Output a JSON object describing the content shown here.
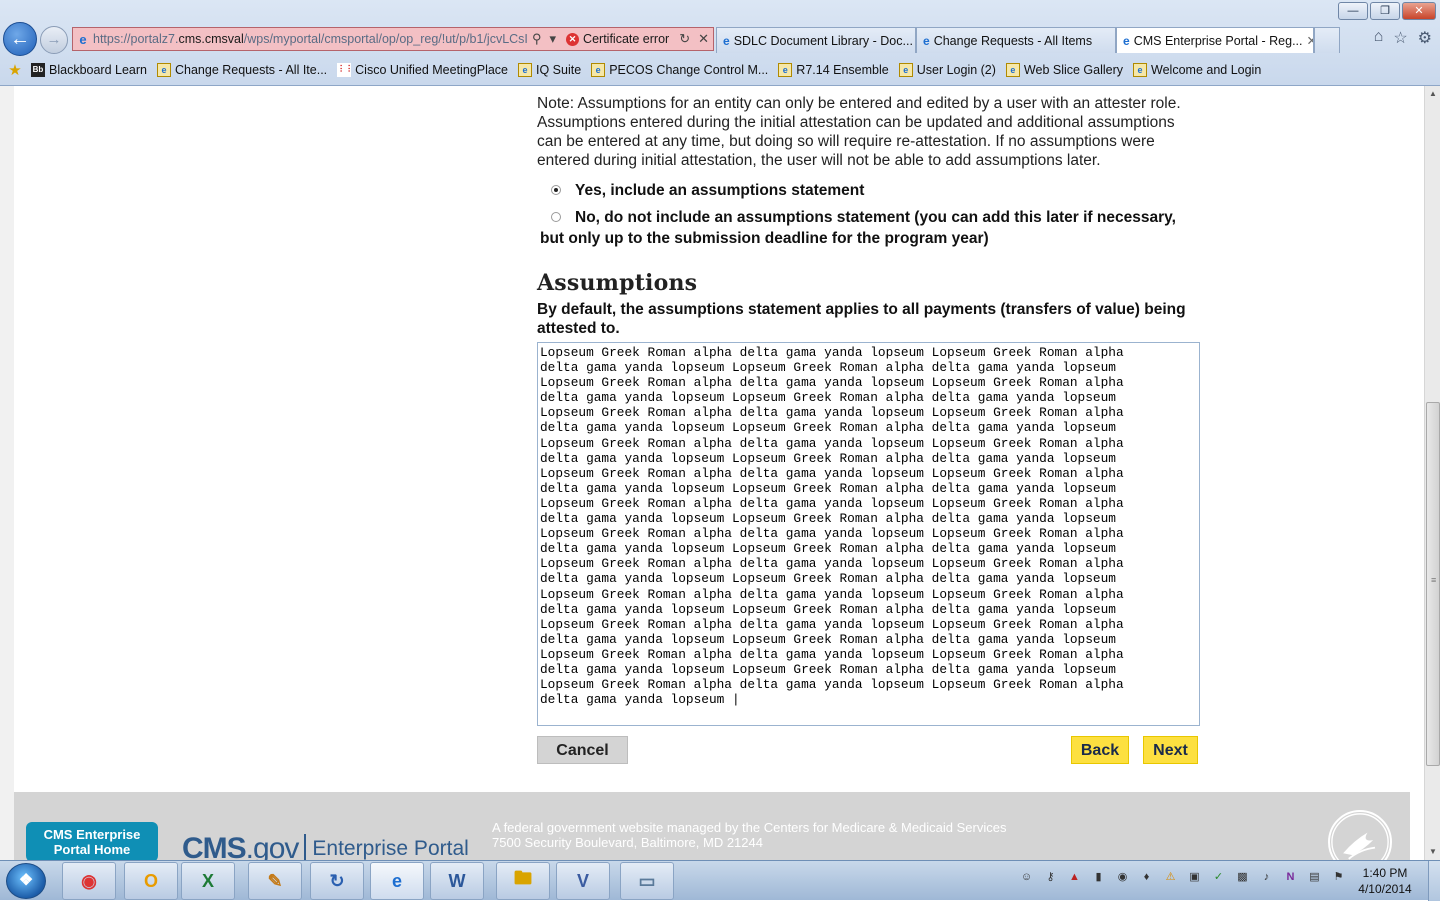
{
  "browser": {
    "window_controls": [
      "minimize",
      "restore",
      "close"
    ],
    "address": {
      "url_prefix": "https://portalz7.",
      "url_domain": "cms.cmsval",
      "url_rest": "/wps/myportal/cmsportal/op/op_reg/!ut/p/b1/jcvLCsI",
      "cert_error": "Certificate error"
    },
    "tabs": [
      {
        "label": "SDLC Document Library - Doc...",
        "active": false
      },
      {
        "label": "Change Requests - All Items",
        "active": false
      },
      {
        "label": "CMS Enterprise Portal - Reg...",
        "active": true
      }
    ],
    "favorites": [
      "Blackboard Learn",
      "Change Requests - All Ite...",
      "Cisco Unified MeetingPlace",
      "IQ Suite",
      "PECOS Change Control M...",
      "R7.14 Ensemble",
      "User Login (2)",
      "Web Slice Gallery",
      "Welcome and Login"
    ]
  },
  "form": {
    "note": "Note: Assumptions for an entity can only be entered and edited by a user with an attester role. Assumptions entered during the initial attestation can be updated and additional assumptions can be entered at any time, but doing so will require re-attestation. If no assumptions were entered during initial attestation, the user will not be able to add assumptions later.",
    "option_yes": "Yes, include an assumptions statement",
    "option_no_line1": "No, do not include an assumptions statement (you can add this later if necessary,",
    "option_no_line2": "but only up to the submission deadline for the program year)",
    "selected_option": "yes",
    "heading": "Assumptions",
    "subheading": "By default, the assumptions statement applies to all payments (transfers of value) being attested to.",
    "textarea_value": "Lopseum Greek Roman alpha delta gama yanda lopseum Lopseum Greek Roman alpha\ndelta gama yanda lopseum Lopseum Greek Roman alpha delta gama yanda lopseum\nLopseum Greek Roman alpha delta gama yanda lopseum Lopseum Greek Roman alpha\ndelta gama yanda lopseum Lopseum Greek Roman alpha delta gama yanda lopseum\nLopseum Greek Roman alpha delta gama yanda lopseum Lopseum Greek Roman alpha\ndelta gama yanda lopseum Lopseum Greek Roman alpha delta gama yanda lopseum\nLopseum Greek Roman alpha delta gama yanda lopseum Lopseum Greek Roman alpha\ndelta gama yanda lopseum Lopseum Greek Roman alpha delta gama yanda lopseum\nLopseum Greek Roman alpha delta gama yanda lopseum Lopseum Greek Roman alpha\ndelta gama yanda lopseum Lopseum Greek Roman alpha delta gama yanda lopseum\nLopseum Greek Roman alpha delta gama yanda lopseum Lopseum Greek Roman alpha\ndelta gama yanda lopseum Lopseum Greek Roman alpha delta gama yanda lopseum\nLopseum Greek Roman alpha delta gama yanda lopseum Lopseum Greek Roman alpha\ndelta gama yanda lopseum Lopseum Greek Roman alpha delta gama yanda lopseum\nLopseum Greek Roman alpha delta gama yanda lopseum Lopseum Greek Roman alpha\ndelta gama yanda lopseum Lopseum Greek Roman alpha delta gama yanda lopseum\nLopseum Greek Roman alpha delta gama yanda lopseum Lopseum Greek Roman alpha\ndelta gama yanda lopseum Lopseum Greek Roman alpha delta gama yanda lopseum\nLopseum Greek Roman alpha delta gama yanda lopseum Lopseum Greek Roman alpha\ndelta gama yanda lopseum Lopseum Greek Roman alpha delta gama yanda lopseum\nLopseum Greek Roman alpha delta gama yanda lopseum Lopseum Greek Roman alpha\ndelta gama yanda lopseum Lopseum Greek Roman alpha delta gama yanda lopseum\nLopseum Greek Roman alpha delta gama yanda lopseum Lopseum Greek Roman alpha\ndelta gama yanda lopseum |",
    "cancel_label": "Cancel",
    "back_label": "Back",
    "next_label": "Next"
  },
  "footer": {
    "home_line1": "CMS Enterprise",
    "home_line2": "Portal Home",
    "logo_cms": "CMS",
    "logo_gov": ".gov",
    "logo_portal": "Enterprise Portal",
    "text_line1": "A federal government website managed by the Centers for Medicare & Medicaid Services",
    "text_line2": "7500 Security Boulevard, Baltimore, MD 21244"
  },
  "taskbar": {
    "apps": [
      "chrome",
      "outlook",
      "excel",
      "paint",
      "app",
      "internet-explorer",
      "word",
      "explorer",
      "visio",
      "app2"
    ],
    "time": "1:40 PM",
    "date": "4/10/2014"
  },
  "colors": {
    "accent_yellow": "#fde040",
    "footer_blue": "#0f8fb5",
    "address_error": "#f3c0c4"
  }
}
